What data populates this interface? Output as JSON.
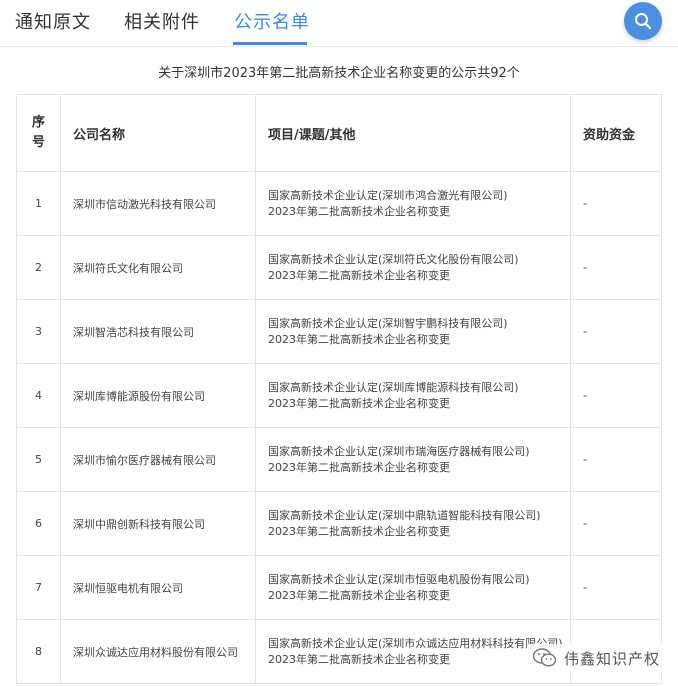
{
  "tabs": [
    {
      "label": "通知原文"
    },
    {
      "label": "相关附件"
    },
    {
      "label": "公示名单",
      "active": true
    }
  ],
  "search": {
    "icon": "search-icon",
    "color": "#4a8fe0"
  },
  "accent_color": "#3d8be0",
  "summary": "关于深圳市2023年第二批高新技术企业名称变更的公示共92个",
  "table": {
    "headers": {
      "no_line1": "序",
      "no_line2": "号",
      "company": "公司名称",
      "project": "项目/课题/其他",
      "funding": "资助资金"
    },
    "rows": [
      {
        "no": "1",
        "company": "深圳市信动激光科技有限公司",
        "project_line1": "国家高新技术企业认定(深圳市鸿合激光有限公司)",
        "project_line2": "2023年第二批高新技术企业名称变更",
        "funding": "-"
      },
      {
        "no": "2",
        "company": "深圳符氏文化有限公司",
        "project_line1": "国家高新技术企业认定(深圳符氏文化股份有限公司)",
        "project_line2": "2023年第二批高新技术企业名称变更",
        "funding": "-"
      },
      {
        "no": "3",
        "company": "深圳智浩芯科技有限公司",
        "project_line1": "国家高新技术企业认定(深圳智宇鹏科技有限公司)",
        "project_line2": "2023年第二批高新技术企业名称变更",
        "funding": "-"
      },
      {
        "no": "4",
        "company": "深圳库博能源股份有限公司",
        "project_line1": "国家高新技术企业认定(深圳库博能源科技有限公司)",
        "project_line2": "2023年第二批高新技术企业名称变更",
        "funding": "-"
      },
      {
        "no": "5",
        "company": "深圳市愉尔医疗器械有限公司",
        "project_line1": "国家高新技术企业认定(深圳市瑞海医疗器械有限公司)",
        "project_line2": "2023年第二批高新技术企业名称变更",
        "funding": "-"
      },
      {
        "no": "6",
        "company": "深圳中鼎创新科技有限公司",
        "project_line1": "国家高新技术企业认定(深圳中鼎轨道智能科技有限公司)",
        "project_line2": "2023年第二批高新技术企业名称变更",
        "funding": "-"
      },
      {
        "no": "7",
        "company": "深圳恒驱电机有限公司",
        "project_line1": "国家高新技术企业认定(深圳市恒驱电机股份有限公司)",
        "project_line2": "2023年第二批高新技术企业名称变更",
        "funding": "-"
      },
      {
        "no": "8",
        "company": "深圳众诚达应用材料股份有限公司",
        "project_line1": "国家高新技术企业认定(深圳市众诚达应用材料科技有限公司)",
        "project_line2": "2023年第二批高新技术企业名称变更",
        "funding": "-"
      }
    ]
  },
  "watermark": {
    "text": "伟鑫知识产权",
    "icon": "wechat-icon"
  }
}
